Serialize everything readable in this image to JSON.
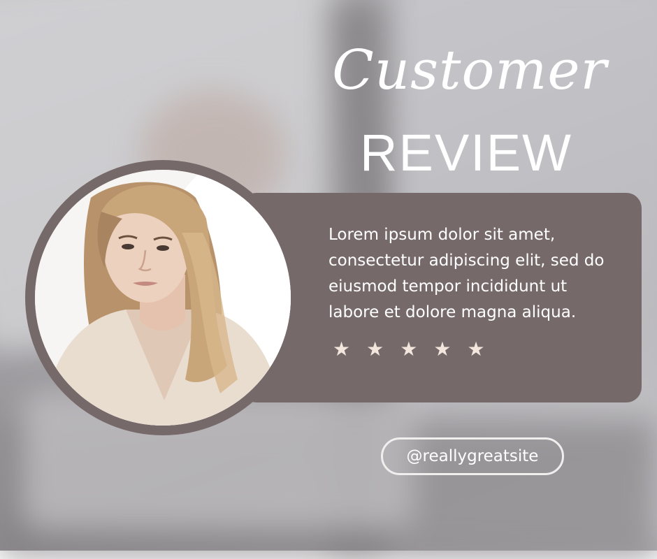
{
  "title": {
    "script": "Customer",
    "caps": "REVIEW"
  },
  "review": {
    "text": "Lorem ipsum dolor sit amet, consectetur adipiscing elit, sed do eiusmod tempor incididunt ut labore et dolore magna aliqua.",
    "rating": 5,
    "star_glyph": "★"
  },
  "handle": "@reallygreatsite",
  "colors": {
    "card": "#76696a",
    "star": "#f3e6dc",
    "text": "#ffffff"
  }
}
